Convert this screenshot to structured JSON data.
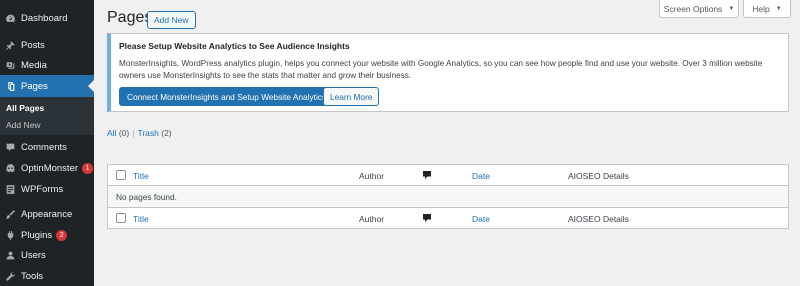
{
  "sidebar": {
    "items": [
      {
        "label": "Dashboard",
        "icon": "dashboard-icon"
      },
      {
        "label": "Posts",
        "icon": "pin-icon"
      },
      {
        "label": "Media",
        "icon": "media-icon"
      },
      {
        "label": "Pages",
        "icon": "pages-icon",
        "active": true
      },
      {
        "label": "Comments",
        "icon": "comment-icon"
      },
      {
        "label": "OptinMonster",
        "icon": "optinmonster-icon",
        "badge": "1"
      },
      {
        "label": "WPForms",
        "icon": "wpforms-icon"
      },
      {
        "label": "Appearance",
        "icon": "brush-icon"
      },
      {
        "label": "Plugins",
        "icon": "plugin-icon",
        "badge": "2"
      },
      {
        "label": "Users",
        "icon": "users-icon"
      },
      {
        "label": "Tools",
        "icon": "wrench-icon"
      }
    ],
    "submenu": [
      "All Pages",
      "Add New"
    ],
    "active_color": "#2271b1",
    "background": "#1d2327"
  },
  "header": {
    "screen_options": "Screen Options",
    "help": "Help",
    "title": "Pages",
    "add_new": "Add New"
  },
  "notice": {
    "title": "Please Setup Website Analytics to See Audience Insights",
    "body": "MonsterInsights, WordPress analytics plugin, helps you connect your website with Google Analytics, so you can see how people find and use your website. Over 3 million website owners use MonsterInsights to see the stats that matter and grow their business.",
    "primary_button": "Connect MonsterInsights and Setup Website Analytics",
    "secondary_button": "Learn More"
  },
  "filters": {
    "all_label": "All",
    "all_count": "(0)",
    "separator": "|",
    "trash_label": "Trash",
    "trash_count": "(2)"
  },
  "table": {
    "columns": {
      "title": "Title",
      "author": "Author",
      "comments_icon": "comment-bubble-icon",
      "date": "Date",
      "aioseo": "AIOSEO Details"
    },
    "empty_message": "No pages found."
  }
}
